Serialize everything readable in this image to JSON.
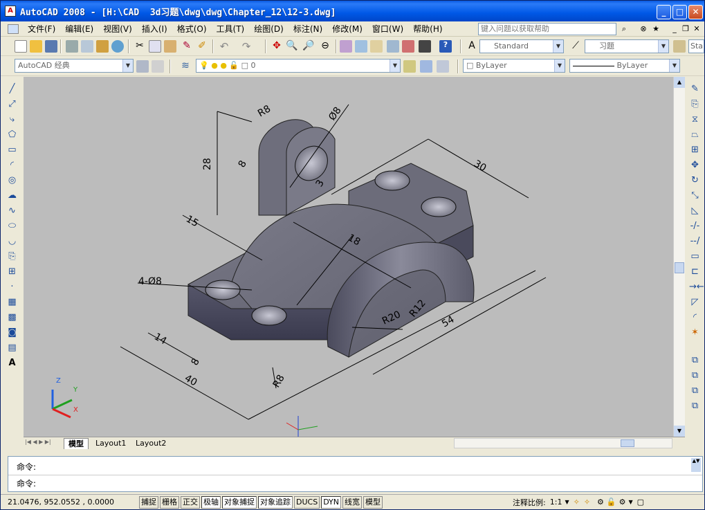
{
  "window": {
    "title": "AutoCAD 2008 - [H:\\CAD  3d习题\\dwg\\dwg\\Chapter_12\\12-3.dwg]"
  },
  "menu": [
    "文件(F)",
    "编辑(E)",
    "视图(V)",
    "插入(I)",
    "格式(O)",
    "工具(T)",
    "绘图(D)",
    "标注(N)",
    "修改(M)",
    "窗口(W)",
    "帮助(H)"
  ],
  "help_search": {
    "placeholder": "键入问题以获取帮助"
  },
  "styles": {
    "text_style": "Standard",
    "dim_style": "习题",
    "table_style": "Sta"
  },
  "workspace": {
    "name": "AutoCAD 经典"
  },
  "layer": {
    "current": "0"
  },
  "properties": {
    "color": "ByLayer",
    "linetype": "ByLayer"
  },
  "drawing": {
    "dims": {
      "r8_top": "R8",
      "d8_top": "Ø8",
      "h28": "28",
      "d8_side": "8",
      "n3": "3",
      "d15": "15",
      "d30": "30",
      "d18": "18",
      "holes": "4-Ø8",
      "d14": "14",
      "d8_bottom": "8",
      "d40": "40",
      "r8_bottom": "R8",
      "r20": "R20",
      "r12": "R12",
      "d54": "54"
    },
    "ucs": {
      "x": "X",
      "y": "Y",
      "z": "Z"
    }
  },
  "tabs": {
    "model": "模型",
    "layout1": "Layout1",
    "layout2": "Layout2"
  },
  "command": {
    "line1": "命令:",
    "line2": "命令:"
  },
  "status": {
    "coords": "21.0476,  952.0552 , 0.0000",
    "toggles": [
      "捕捉",
      "栅格",
      "正交",
      "极轴",
      "对象捕捉",
      "对象追踪",
      "DUCS",
      "DYN",
      "线宽",
      "模型"
    ],
    "annotation_scale_label": "注释比例:",
    "annotation_scale": "1:1"
  }
}
